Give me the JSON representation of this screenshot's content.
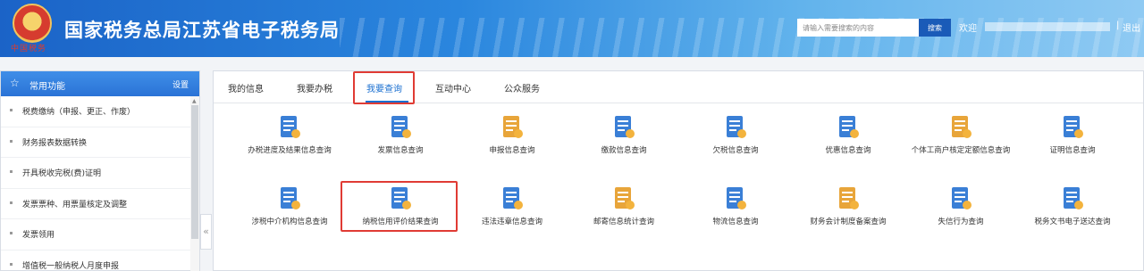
{
  "header": {
    "site_title": "国家税务总局江苏省电子税务局",
    "emblem_text": "中国税务",
    "search_placeholder": "请输入需要搜索的内容",
    "search_button": "搜索",
    "welcome": "欢迎",
    "separator": "|",
    "logout": "退出"
  },
  "sidebar": {
    "title": "常用功能",
    "settings": "设置",
    "items": [
      "税费缴纳（申报、更正、作废）",
      "财务报表数据转换",
      "开具税收完税(费)证明",
      "发票票种、用票量核定及调整",
      "发票领用",
      "增值税一般纳税人月度申报"
    ],
    "collapse_icon": "«"
  },
  "tabs": [
    "我的信息",
    "我要办税",
    "我要查询",
    "互动中心",
    "公众服务"
  ],
  "active_tab": "我要查询",
  "query_items": [
    {
      "label": "办税进度及结果信息查询",
      "icon": "document-search-icon",
      "color": "#3a7fd6"
    },
    {
      "label": "发票信息查询",
      "icon": "invoice-icon",
      "color": "#3a7fd6"
    },
    {
      "label": "申报信息查询",
      "icon": "declaration-chart-icon",
      "color": "#e8a53a"
    },
    {
      "label": "缴款信息查询",
      "icon": "payment-chart-icon",
      "color": "#3a7fd6"
    },
    {
      "label": "欠税信息查询",
      "icon": "tax-arrears-icon",
      "color": "#3a7fd6"
    },
    {
      "label": "优惠信息查询",
      "icon": "preferential-icon",
      "color": "#3a7fd6"
    },
    {
      "label": "个体工商户核定定额信息查询",
      "icon": "individual-business-icon",
      "color": "#e8a53a"
    },
    {
      "label": "证明信息查询",
      "icon": "certificate-screen-icon",
      "color": "#3a7fd6"
    },
    {
      "label": "涉税中介机构信息查询",
      "icon": "agency-icon",
      "color": "#3a7fd6"
    },
    {
      "label": "纳税信用评价结果查询",
      "icon": "credit-rating-icon",
      "color": "#3a7fd6"
    },
    {
      "label": "违法违章信息查询",
      "icon": "violation-folder-icon",
      "color": "#3a7fd6"
    },
    {
      "label": "邮寄信息统计查询",
      "icon": "mail-stats-icon",
      "color": "#e8a53a"
    },
    {
      "label": "物流信息查询",
      "icon": "logistics-folder-icon",
      "color": "#3a7fd6"
    },
    {
      "label": "财务会计制度备案查询",
      "icon": "accounting-filing-icon",
      "color": "#e8a53a"
    },
    {
      "label": "失信行为查询",
      "icon": "dishonesty-icon",
      "color": "#3a7fd6"
    },
    {
      "label": "税务文书电子送达查询",
      "icon": "e-document-icon",
      "color": "#3a7fd6"
    }
  ]
}
